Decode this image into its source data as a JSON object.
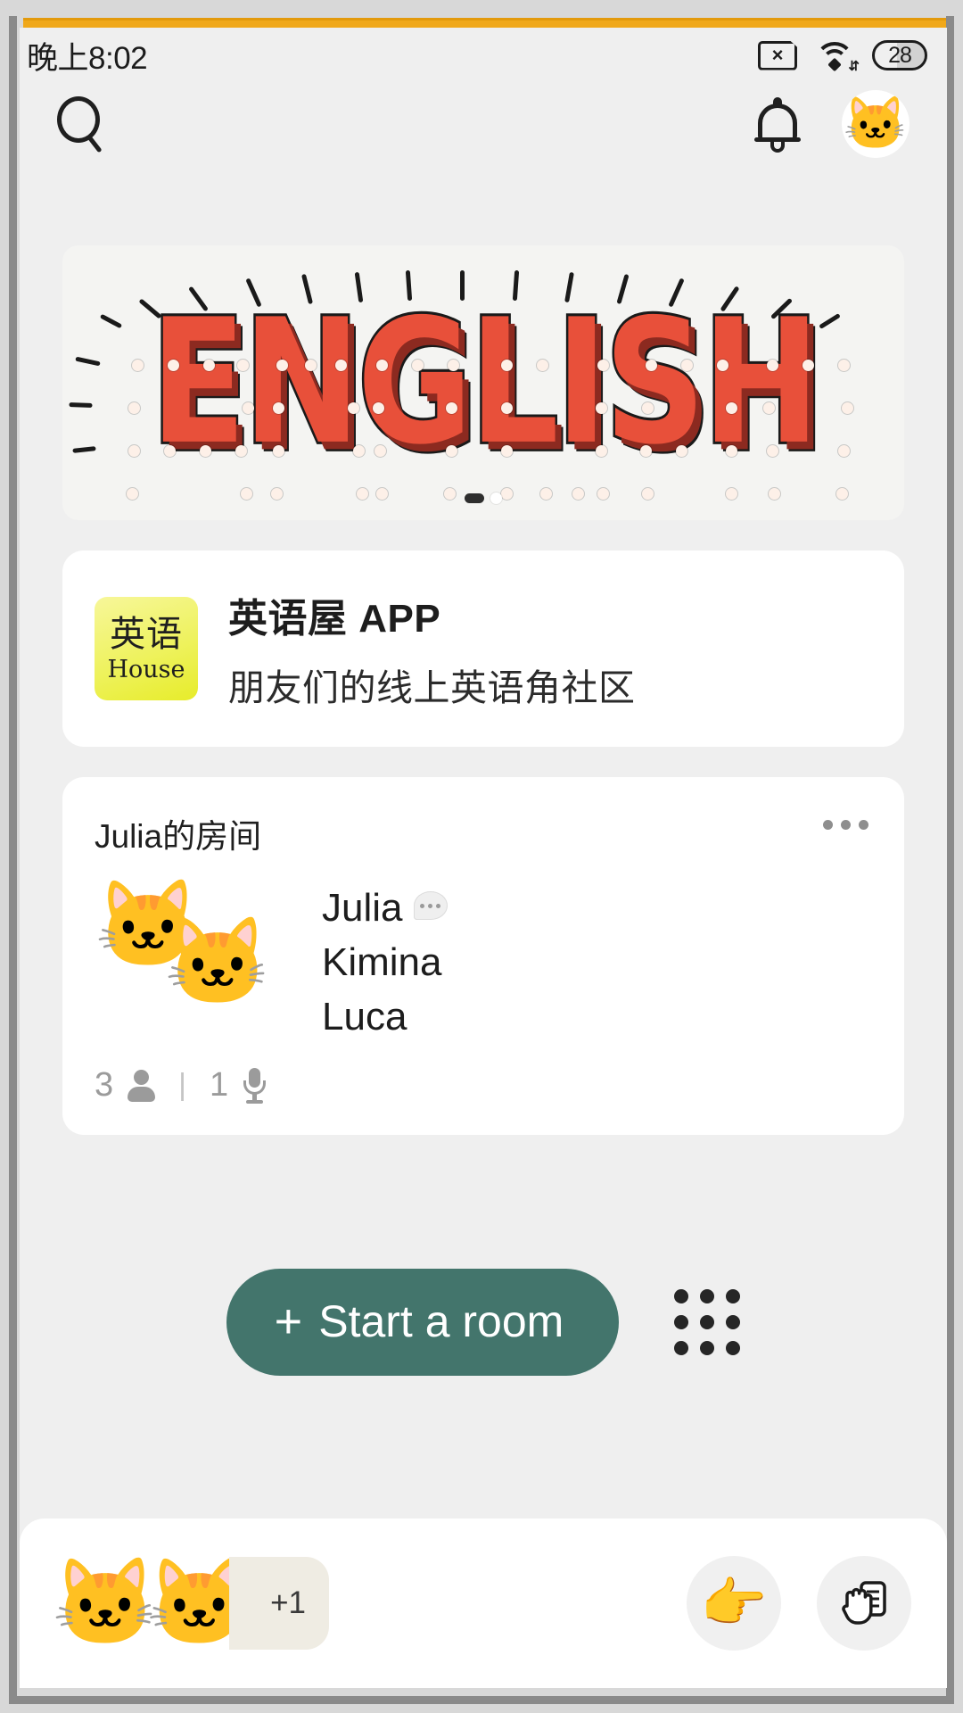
{
  "status_bar": {
    "time": "晚上8:02",
    "sim_icon": "sim-card-off-icon",
    "sim_glyph": "×",
    "wifi_icon": "wifi-icon",
    "battery_level": "28"
  },
  "header": {
    "search_icon": "search-icon",
    "bell_icon": "notification-bell-icon",
    "avatar_emoji": "😎🐱",
    "avatar_glyph": "🐱"
  },
  "banner": {
    "word": "ENGLISH",
    "dots_total": 2,
    "active_index": 0
  },
  "app_card": {
    "logo_cn": "英语",
    "logo_en": "House",
    "title": "英语屋 APP",
    "subtitle": "朋友们的线上英语角社区"
  },
  "room_card": {
    "title": "Julia的房间",
    "more_icon": "more-options-icon",
    "avatars": [
      "🐱",
      "🐱"
    ],
    "members": [
      {
        "name": "Julia",
        "speaking": true
      },
      {
        "name": "Kimina",
        "speaking": false
      },
      {
        "name": "Luca",
        "speaking": false
      }
    ],
    "people_count": "3",
    "people_icon": "person-icon",
    "separator": "|",
    "speaker_count": "1",
    "mic_icon": "microphone-icon"
  },
  "cta": {
    "plus": "+",
    "start_room_label": "Start a room",
    "grid_icon": "grid-apps-icon",
    "button_color": "#43756c"
  },
  "bottom_bar": {
    "avatars": [
      "🐱",
      "🐱"
    ],
    "overflow_label": "+1",
    "action_pointer_icon": "pointing-hand-icon",
    "action_pointer_glyph": "👉",
    "action_wave_icon": "raise-hand-document-icon",
    "action_wave_glyph": "✋"
  }
}
